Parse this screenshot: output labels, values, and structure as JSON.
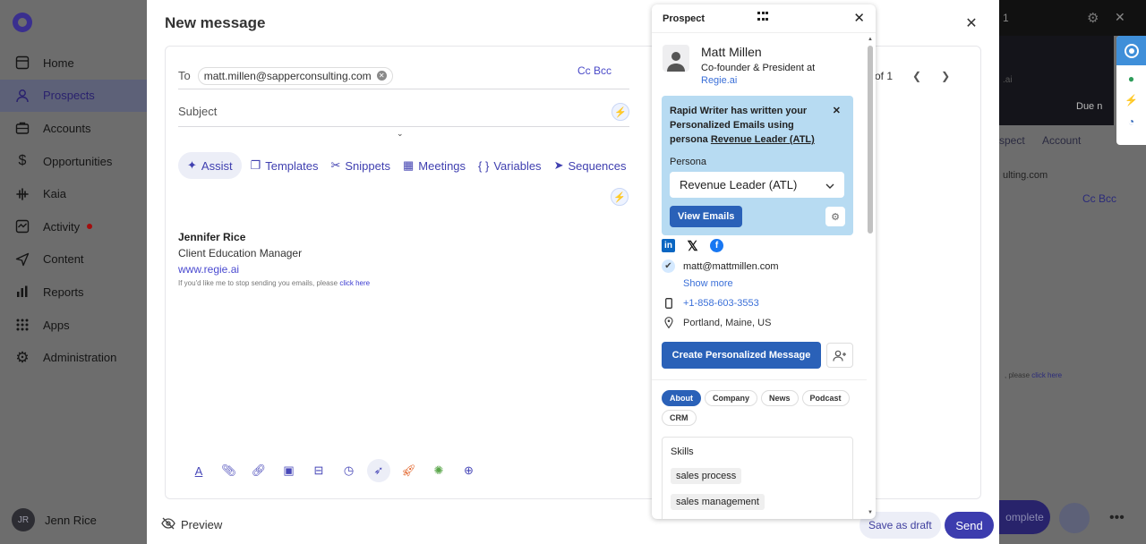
{
  "sidebar": {
    "items": [
      {
        "label": "Home",
        "icon": "home-icon"
      },
      {
        "label": "Prospects",
        "icon": "person-icon",
        "active": true
      },
      {
        "label": "Accounts",
        "icon": "briefcase-icon"
      },
      {
        "label": "Opportunities",
        "icon": "dollar-icon"
      },
      {
        "label": "Kaia",
        "icon": "waveform-icon"
      },
      {
        "label": "Activity",
        "icon": "activity-icon",
        "badge": true
      },
      {
        "label": "Content",
        "icon": "send-icon"
      },
      {
        "label": "Reports",
        "icon": "bar-chart-icon"
      },
      {
        "label": "Apps",
        "icon": "grid-icon"
      },
      {
        "label": "Administration",
        "icon": "gear-icon"
      }
    ],
    "user": {
      "initials": "JR",
      "name": "Jenn Rice"
    }
  },
  "background": {
    "counter": "1",
    "due_label": "Due n",
    "tab_prospect": "spect",
    "tab_account": "Account",
    "email_partial": "ulting.com",
    "cc_bcc": "Cc Bcc",
    "unsub_partial": ", please",
    "unsub_link": "click here",
    "complete_label": "omplete",
    "ai_partial": ".ai"
  },
  "modal": {
    "title": "New message",
    "to_label": "To",
    "recipient": "matt.millen@sapperconsulting.com",
    "cc_bcc": "Cc Bcc",
    "subject_placeholder": "Subject",
    "pager": "of 1",
    "tools": [
      {
        "label": "Assist",
        "icon": "sparkle-icon",
        "active": true
      },
      {
        "label": "Templates",
        "icon": "templates-icon"
      },
      {
        "label": "Snippets",
        "icon": "scissors-icon"
      },
      {
        "label": "Meetings",
        "icon": "calendar-icon"
      },
      {
        "label": "Variables",
        "icon": "braces-icon"
      },
      {
        "label": "Sequences",
        "icon": "send-icon"
      }
    ],
    "signature": {
      "name": "Jennifer Rice",
      "role": "Client Education Manager",
      "website": "www.regie.ai",
      "unsubscribe_text": "If you'd like me to stop sending you emails, please",
      "unsubscribe_link": "click here"
    },
    "format_tools": [
      "text-format-icon",
      "attachment-icon",
      "link-icon",
      "image-icon",
      "snippet-icon",
      "clock-icon",
      "cursor-icon",
      "rocket-icon",
      "bug-icon",
      "plus-circle-icon"
    ],
    "preview_label": "Preview",
    "save_draft_label": "Save as draft",
    "send_label": "Send"
  },
  "prospect_panel": {
    "title": "Prospect",
    "name": "Matt Millen",
    "title_line": "Co-founder & President at",
    "company": "Regie.ai",
    "rapid_writer": {
      "message_start": "Rapid Writer has written your Personalized Emails using persona",
      "persona_link": "Revenue Leader (ATL)",
      "persona_label": "Persona",
      "persona_value": "Revenue Leader (ATL)",
      "view_emails_label": "View Emails"
    },
    "email": "matt@mattmillen.com",
    "show_more": "Show more",
    "phone": "+1-858-603-3553",
    "location": "Portland, Maine, US",
    "create_label": "Create Personalized Message",
    "tabs": [
      {
        "label": "About",
        "active": true
      },
      {
        "label": "Company"
      },
      {
        "label": "News"
      },
      {
        "label": "Podcast"
      },
      {
        "label": "CRM"
      }
    ],
    "skills_header": "Skills",
    "skills": [
      "sales process",
      "sales management"
    ]
  }
}
